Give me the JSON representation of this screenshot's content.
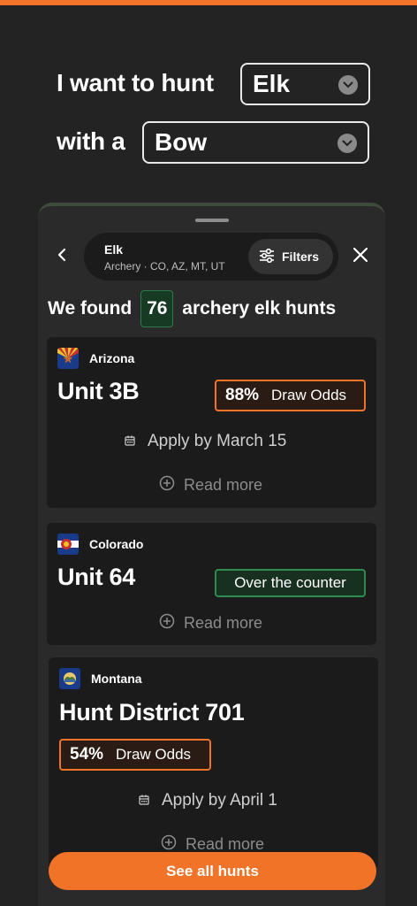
{
  "query": {
    "lead1": "I want to hunt",
    "species": "Elk",
    "lead2": "with a",
    "weapon": "Bow"
  },
  "search_bar": {
    "title": "Elk",
    "subtitle": "Archery · CO, AZ, MT, UT",
    "filters_label": "Filters"
  },
  "results": {
    "prefix": "We found",
    "count": "76",
    "suffix": "archery elk hunts"
  },
  "cards": [
    {
      "state": "Arizona",
      "unit": "Unit 3B",
      "odds_pct": "88%",
      "odds_label": "Draw Odds",
      "apply": "Apply by March 15",
      "read_more": "Read more"
    },
    {
      "state": "Colorado",
      "unit": "Unit 64",
      "tag": "Over the counter",
      "read_more": "Read more"
    },
    {
      "state": "Montana",
      "unit": "Hunt District 701",
      "odds_pct": "54%",
      "odds_label": "Draw Odds",
      "apply": "Apply by April 1",
      "read_more": "Read more"
    }
  ],
  "cta": {
    "label": "See all hunts"
  },
  "colors": {
    "accent": "#f07328",
    "background": "#232323",
    "card": "#1b1b1b",
    "otc_green": "#2f8a50"
  },
  "icons": [
    "chevron-down-icon",
    "back-arrow-icon",
    "sliders-icon",
    "close-icon",
    "calendar-icon",
    "plus-circle-icon"
  ]
}
